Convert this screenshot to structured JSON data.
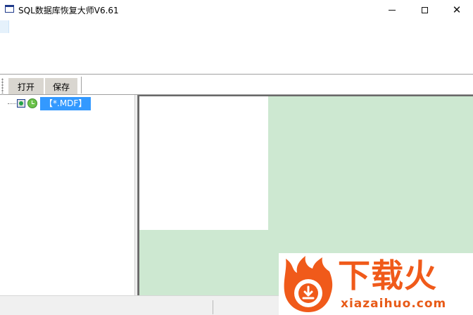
{
  "window": {
    "title": "SQL数据库恢复大师V6.61",
    "icon": "window-icon"
  },
  "toolbar": {
    "open_label": "打开",
    "save_label": "保存"
  },
  "tree": {
    "items": [
      {
        "label": "【*.MDF】",
        "selected": true,
        "icons": [
          "database-node-icon",
          "clock-icon"
        ]
      }
    ]
  },
  "watermark": {
    "title": "下载火",
    "domain": "xiazaihuo.com"
  },
  "colors": {
    "selection": "#3399ff",
    "content_background": "#cde8d1",
    "watermark_orange": "#f05a1a"
  }
}
